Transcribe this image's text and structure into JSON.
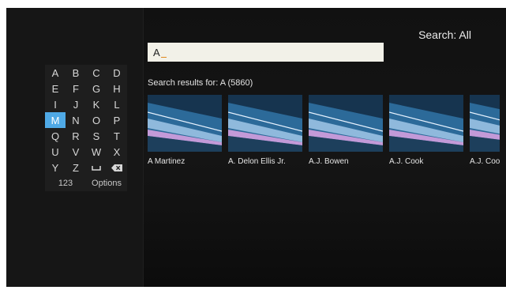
{
  "search_scope": "Search: All",
  "query": "A",
  "results_title": "Search results for: A (5860)",
  "keyboard": {
    "rows": [
      [
        "A",
        "B",
        "C",
        "D"
      ],
      [
        "E",
        "F",
        "G",
        "H"
      ],
      [
        "I",
        "J",
        "K",
        "L"
      ],
      [
        "M",
        "N",
        "O",
        "P"
      ],
      [
        "Q",
        "R",
        "S",
        "T"
      ],
      [
        "U",
        "V",
        "W",
        "X"
      ],
      [
        "Y",
        "Z"
      ]
    ],
    "selected_key": "M",
    "numbers_label": "123",
    "options_label": "Options"
  },
  "results": [
    {
      "name": "A Martinez"
    },
    {
      "name": "A. Delon Ellis Jr."
    },
    {
      "name": "A.J. Bowen"
    },
    {
      "name": "A.J. Cook"
    },
    {
      "name": "A.J. Coo"
    }
  ],
  "colors": {
    "selected_key": "#4fa9e6",
    "cursor": "#e08a1e",
    "search_box": "#f2f1e8"
  }
}
